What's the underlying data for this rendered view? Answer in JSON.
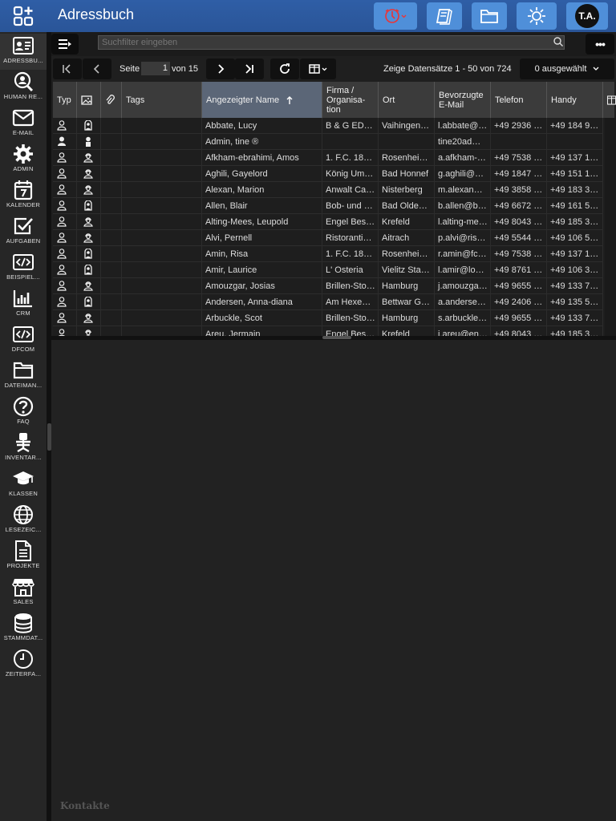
{
  "header": {
    "title": "Adressbuch",
    "avatar_initials": "T.A.",
    "buttons": [
      "timer-icon",
      "book-icon",
      "folder-icon",
      "brightness-icon"
    ]
  },
  "sidebar": {
    "items": [
      {
        "label": "ADRESSBU...",
        "icon": "addressbook-icon"
      },
      {
        "label": "HUMAN RE...",
        "icon": "human-resources-icon"
      },
      {
        "label": "E-MAIL",
        "icon": "email-icon"
      },
      {
        "label": "ADMIN",
        "icon": "gear-icon"
      },
      {
        "label": "KALENDER",
        "icon": "calendar-icon"
      },
      {
        "label": "AUFGABEN",
        "icon": "tasks-icon"
      },
      {
        "label": "BEISPIEL...",
        "icon": "code-icon"
      },
      {
        "label": "CRM",
        "icon": "crm-chart-icon"
      },
      {
        "label": "DFCOM",
        "icon": "code-icon"
      },
      {
        "label": "DATEIMAN...",
        "icon": "folder-icon"
      },
      {
        "label": "FAQ",
        "icon": "faq-icon"
      },
      {
        "label": "INVENTAR...",
        "icon": "chair-icon"
      },
      {
        "label": "KLASSEN",
        "icon": "graduation-cap-icon"
      },
      {
        "label": "LESEZEIC...",
        "icon": "globe-icon"
      },
      {
        "label": "PROJEKTE",
        "icon": "document-icon"
      },
      {
        "label": "SALES",
        "icon": "store-icon"
      },
      {
        "label": "STAMMDAT...",
        "icon": "database-icon"
      },
      {
        "label": "ZEITERFA...",
        "icon": "clock-icon"
      }
    ]
  },
  "search": {
    "placeholder": "Suchfilter eingeben"
  },
  "paging": {
    "page_label": "Seite",
    "page_value": "1",
    "of_label": "von 15",
    "summary": "Zeige Datensätze 1 - 50 von 724",
    "selected": "0 ausgewählt"
  },
  "columns": [
    "Typ",
    "",
    "",
    "Tags",
    "Angezeigter Name",
    "Firma / Organisa- tion",
    "Ort",
    "Bevorzugte E-Mail",
    "Telefon",
    "Handy"
  ],
  "rows": [
    {
      "name": "Abbate, Lucy",
      "firma": "B & G ED…",
      "ort": "Vaihingen…",
      "email": "l.abbate@…",
      "telefon": "+49 2936 …",
      "handy": "+49 184 9…",
      "type": "contact",
      "img": "female"
    },
    {
      "name": "Admin, tine ®",
      "firma": "",
      "ort": "",
      "email": "tine20ad…",
      "telefon": "",
      "handy": "",
      "type": "user",
      "img": "user"
    },
    {
      "name": "Afkham-ebrahimi, Amos",
      "firma": "1. F.C. 18…",
      "ort": "Rosenhei…",
      "email": "a.afkham-…",
      "telefon": "+49 7538 …",
      "handy": "+49 137 1…",
      "type": "contact",
      "img": "male"
    },
    {
      "name": "Aghili, Gayelord",
      "firma": "König Um…",
      "ort": "Bad Honnef",
      "email": "g.aghili@…",
      "telefon": "+49 1847 …",
      "handy": "+49 151 1…",
      "type": "contact",
      "img": "male"
    },
    {
      "name": "Alexan, Marion",
      "firma": "Anwalt Ca…",
      "ort": "Nisterberg",
      "email": "m.alexan…",
      "telefon": "+49 3858 …",
      "handy": "+49 183 3…",
      "type": "contact",
      "img": "male"
    },
    {
      "name": "Allen, Blair",
      "firma": "Bob- und …",
      "ort": "Bad Olde…",
      "email": "b.allen@b…",
      "telefon": "+49 6672 …",
      "handy": "+49 161 5…",
      "type": "contact",
      "img": "female"
    },
    {
      "name": "Alting-Mees, Leupold",
      "firma": "Engel Bes…",
      "ort": "Krefeld",
      "email": "l.alting-me…",
      "telefon": "+49 8043 …",
      "handy": "+49 185 3…",
      "type": "contact",
      "img": "male"
    },
    {
      "name": "Alvi, Pernell",
      "firma": "Ristoranti…",
      "ort": "Aitrach",
      "email": "p.alvi@ris…",
      "telefon": "+49 5544 …",
      "handy": "+49 106 5…",
      "type": "contact",
      "img": "male"
    },
    {
      "name": "Amin, Risa",
      "firma": "1. F.C. 18…",
      "ort": "Rosenhei…",
      "email": "r.amin@fc…",
      "telefon": "+49 7538 …",
      "handy": "+49 137 1…",
      "type": "contact",
      "img": "female"
    },
    {
      "name": "Amir, Laurice",
      "firma": "L' Osteria",
      "ort": "Vielitz Sta…",
      "email": "l.amir@lo…",
      "telefon": "+49 8761 …",
      "handy": "+49 106 3…",
      "type": "contact",
      "img": "female"
    },
    {
      "name": "Amouzgar, Josias",
      "firma": "Brillen-Sto…",
      "ort": "Hamburg",
      "email": "j.amouzga…",
      "telefon": "+49 9655 …",
      "handy": "+49 133 7…",
      "type": "contact",
      "img": "male"
    },
    {
      "name": "Andersen, Anna-diana",
      "firma": "Am Hexe…",
      "ort": "Bettwar G…",
      "email": "a.anderse…",
      "telefon": "+49 2406 …",
      "handy": "+49 135 5…",
      "type": "contact",
      "img": "female"
    },
    {
      "name": "Arbuckle, Scot",
      "firma": "Brillen-Sto…",
      "ort": "Hamburg",
      "email": "s.arbuckle…",
      "telefon": "+49 9655 …",
      "handy": "+49 133 7…",
      "type": "contact",
      "img": "male"
    },
    {
      "name": "Areu, Jermain",
      "firma": "Engel Bes…",
      "ort": "Krefeld",
      "email": "j.areu@en…",
      "telefon": "+49 8043 …",
      "handy": "+49 185 3…",
      "type": "contact",
      "img": "male"
    }
  ],
  "detail": {
    "footer_label": "Kontakte"
  },
  "colors": {
    "topbar": "#2f5ea6",
    "button": "#4f8fd9",
    "sorted_header": "#5b6677"
  }
}
